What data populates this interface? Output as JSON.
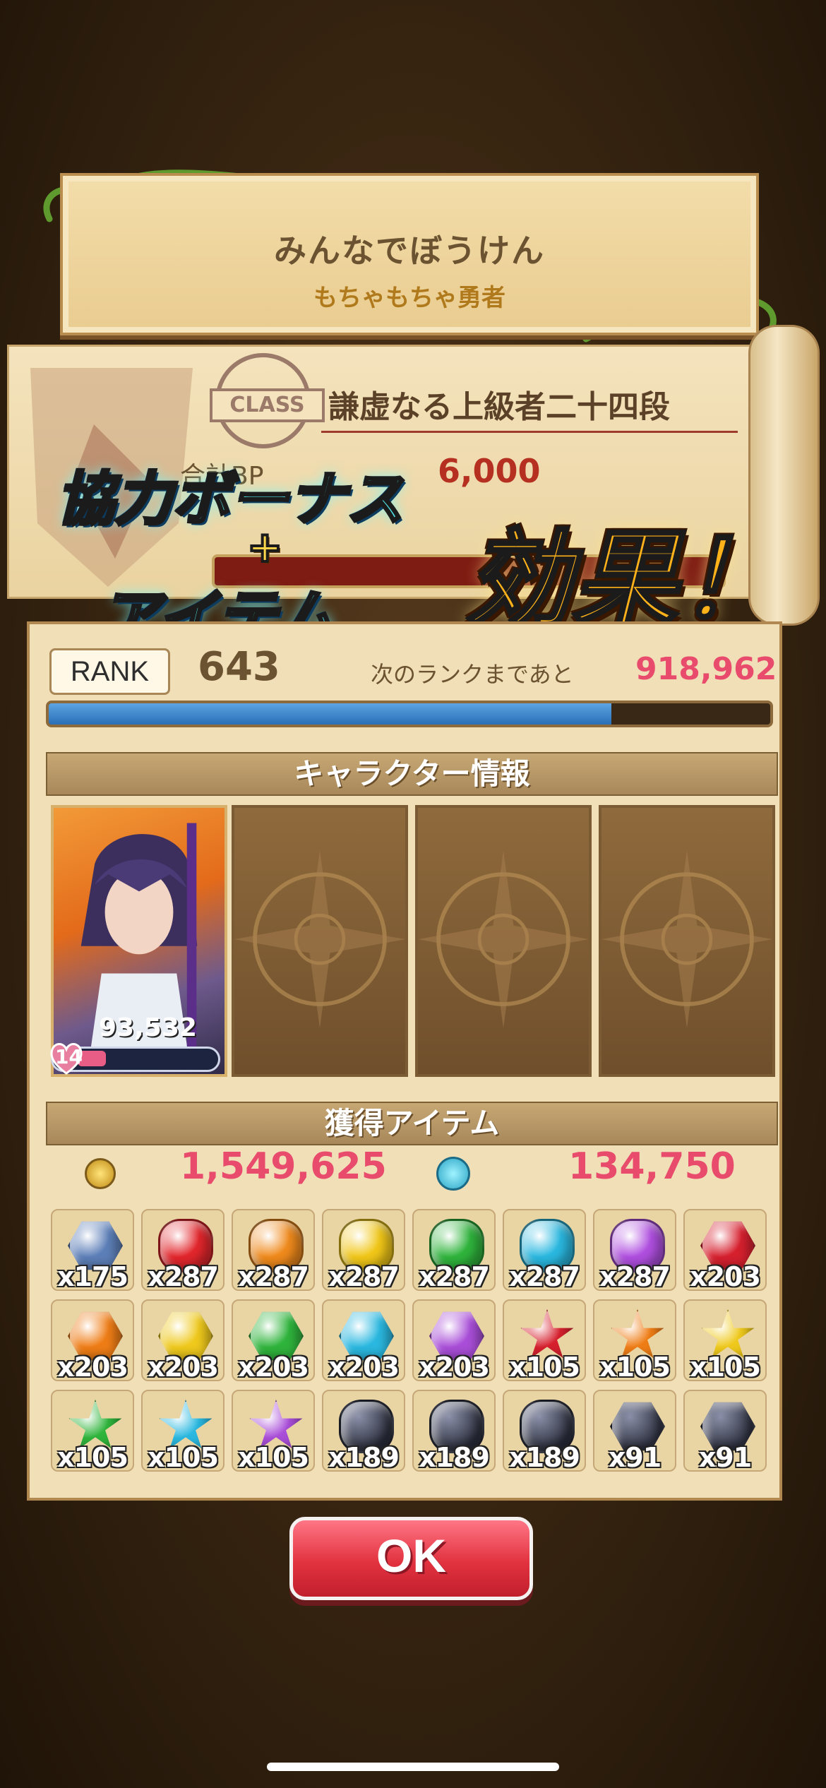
{
  "banner": {
    "title": "みんなでぼうけん",
    "subtitle": "もちゃもちゃ勇者"
  },
  "class_info": {
    "stamp": "CLASS",
    "title": "謙虚なる上級者二十四段",
    "bp_label": "合計BP",
    "bp_value": "6,000"
  },
  "promo": {
    "line1": "協力ボーナス",
    "plus": "+",
    "line2": "アイテム",
    "line3": "効果！"
  },
  "rank": {
    "badge": "RANK",
    "value": "643",
    "next_label": "次のランクまであと",
    "next_value": "918,962",
    "progress": 0.78
  },
  "character_section": {
    "title": "キャラクター情報",
    "power": "93,532",
    "level": "14",
    "level_progress": 0.2
  },
  "items_section": {
    "title": "獲得アイテム",
    "coins": "1,549,625",
    "orbs": "134,750"
  },
  "items": [
    {
      "qty": "x175",
      "color": "#5d7fb8",
      "shape": "hex",
      "icon": "medal-gem-icon"
    },
    {
      "qty": "x287",
      "color": "#e2262c",
      "shape": "drop",
      "icon": "red-gem-icon"
    },
    {
      "qty": "x287",
      "color": "#f08a1c",
      "shape": "drop",
      "icon": "orange-gem-icon"
    },
    {
      "qty": "x287",
      "color": "#f1c718",
      "shape": "drop",
      "icon": "yellow-gem-icon"
    },
    {
      "qty": "x287",
      "color": "#2fb43c",
      "shape": "drop",
      "icon": "green-gem-icon"
    },
    {
      "qty": "x287",
      "color": "#2ab8e0",
      "shape": "drop",
      "icon": "cyan-gem-icon"
    },
    {
      "qty": "x287",
      "color": "#b04fe0",
      "shape": "drop",
      "icon": "purple-gem-icon"
    },
    {
      "qty": "x203",
      "color": "#d6202e",
      "shape": "hex",
      "icon": "red-crystal-icon"
    },
    {
      "qty": "x203",
      "color": "#ef7d16",
      "shape": "hex",
      "icon": "orange-crystal-icon"
    },
    {
      "qty": "x203",
      "color": "#efc91c",
      "shape": "hex",
      "icon": "yellow-crystal-icon"
    },
    {
      "qty": "x203",
      "color": "#2fb43c",
      "shape": "hex",
      "icon": "green-crystal-icon"
    },
    {
      "qty": "x203",
      "color": "#2ab8e0",
      "shape": "hex",
      "icon": "cyan-crystal-icon"
    },
    {
      "qty": "x203",
      "color": "#a94ed8",
      "shape": "hex",
      "icon": "purple-crystal-icon"
    },
    {
      "qty": "x105",
      "color": "#d6202e",
      "shape": "star",
      "icon": "red-star-gem-icon"
    },
    {
      "qty": "x105",
      "color": "#ef7d16",
      "shape": "star",
      "icon": "orange-star-gem-icon"
    },
    {
      "qty": "x105",
      "color": "#efc91c",
      "shape": "star",
      "icon": "yellow-star-gem-icon"
    },
    {
      "qty": "x105",
      "color": "#2fb43c",
      "shape": "star",
      "icon": "green-star-gem-icon"
    },
    {
      "qty": "x105",
      "color": "#2ab8e0",
      "shape": "star",
      "icon": "cyan-star-gem-icon"
    },
    {
      "qty": "x105",
      "color": "#a94ed8",
      "shape": "star",
      "icon": "purple-star-gem-icon"
    },
    {
      "qty": "x189",
      "color": "#2c2f3d",
      "shape": "drop",
      "icon": "dark-stone-green-icon"
    },
    {
      "qty": "x189",
      "color": "#2c2f3d",
      "shape": "drop",
      "icon": "dark-stone-pink-icon"
    },
    {
      "qty": "x189",
      "color": "#2c2f3d",
      "shape": "drop",
      "icon": "dark-stone-purple-icon"
    },
    {
      "qty": "x91",
      "color": "#2c2f3d",
      "shape": "hex",
      "icon": "dark-crystal-green-icon"
    },
    {
      "qty": "x91",
      "color": "#2c2f3d",
      "shape": "hex",
      "icon": "dark-crystal-pink-icon"
    }
  ],
  "ok_button": {
    "label": "OK"
  }
}
